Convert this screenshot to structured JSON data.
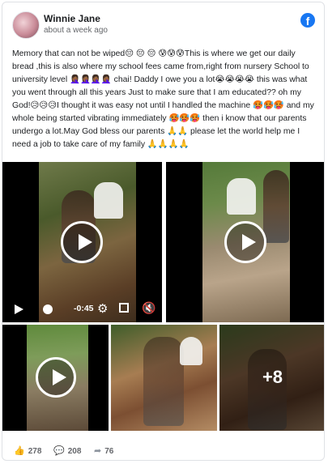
{
  "post": {
    "author": "Winnie Jane",
    "time": "about a week ago",
    "text": "Memory that can not be wiped😔 😔 😔 😰😰😰This is where we get our daily bread ,this is also where my school fees came from,right from nursery School to university level 🤦🏾‍♀️🤦🏾‍♀️🤦🏾‍♀️🤦🏾‍♀️ chai! Daddy I owe you a lot😭😭😭😭 this was what you went through all this years Just to make sure that I am educated?? oh my God!😥😥😥I thought it was easy not until I handled the machine 🥵🥵🥵 and my whole being started vibrating immediately 🥵🥵🥵 then i know that our parents undergo a lot.May God bless our parents 🙏🙏 please let the world help me I need a job to take care of my family 🙏🙏🙏🙏"
  },
  "brand": {
    "logo_letter": "f",
    "color": "#1877f2"
  },
  "media": {
    "video_controls": {
      "time": "-0:45"
    },
    "more_count": "+8"
  },
  "stats": {
    "likes": "278",
    "comments": "208",
    "shares": "76"
  },
  "icons": {
    "like": "thumbs-up-icon",
    "comment": "comment-icon",
    "share": "share-icon",
    "settings": "gear-icon",
    "volume": "volume-icon"
  }
}
